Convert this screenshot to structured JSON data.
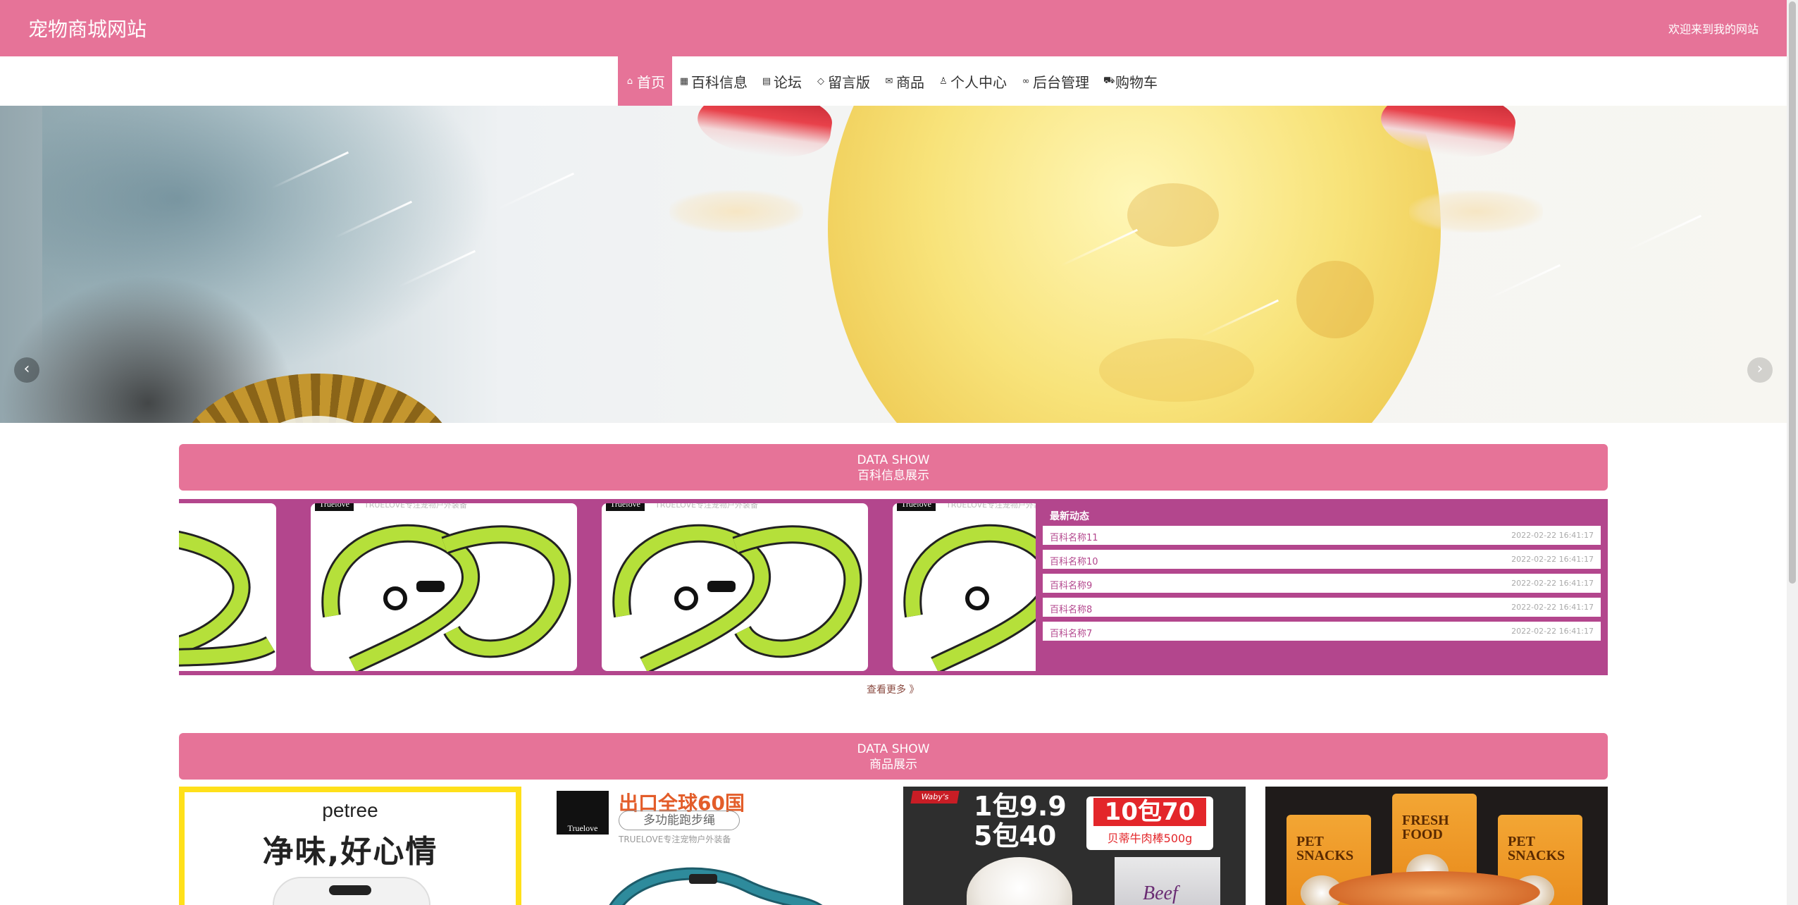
{
  "header": {
    "site_title": "宠物商城网站",
    "welcome": "欢迎来到我的网站"
  },
  "nav": {
    "items": [
      {
        "label": "首页",
        "icon": "home-icon",
        "active": true
      },
      {
        "label": "百科信息",
        "icon": "gift-icon",
        "active": false
      },
      {
        "label": "论坛",
        "icon": "forum-icon",
        "active": false
      },
      {
        "label": "留言版",
        "icon": "tag-icon",
        "active": false
      },
      {
        "label": "商品",
        "icon": "mail-icon",
        "active": false
      },
      {
        "label": "个人中心",
        "icon": "user-icon",
        "active": false
      },
      {
        "label": "后台管理",
        "icon": "link-icon",
        "active": false
      },
      {
        "label": "购物车",
        "icon": "cart-icon",
        "active": false
      }
    ]
  },
  "carousel": {
    "prev_icon": "chevron-left-icon",
    "next_icon": "chevron-right-icon",
    "slide_count": 3,
    "active_slide": 1
  },
  "encyclopedia_section": {
    "heading_en": "DATA SHOW",
    "heading_cn": "百科信息展示",
    "slide_brand": "Truelove",
    "slide_tagline": "TRUELOVE专注宠物户外装备",
    "news_title": "最新动态",
    "news": [
      {
        "name": "百科名称11",
        "time": "2022-02-22 16:41:17"
      },
      {
        "name": "百科名称10",
        "time": "2022-02-22 16:41:17"
      },
      {
        "name": "百科名称9",
        "time": "2022-02-22 16:41:17"
      },
      {
        "name": "百科名称8",
        "time": "2022-02-22 16:41:17"
      },
      {
        "name": "百科名称7",
        "time": "2022-02-22 16:41:17"
      }
    ],
    "more_label": "查看更多 》"
  },
  "product_section": {
    "heading_en": "DATA SHOW",
    "heading_cn": "商品展示",
    "p1": {
      "brand": "petree",
      "slogan": "净味,好心情"
    },
    "p2": {
      "logo": "Truelove",
      "headline": "出口全球60国",
      "subhead": "多功能跑步绳",
      "tagline": "TRUELOVE专注宠物户外装备"
    },
    "p3": {
      "tag": "Waby's",
      "line1": "1包9.9",
      "line2": "5包40",
      "badge": "10包70",
      "badge_sub": "贝蒂牛肉棒500g",
      "bag_text": "Beef"
    },
    "p4": {
      "pack_text_1": "PET SNACKS",
      "pack_text_2": "FRESH FOOD"
    }
  },
  "colors": {
    "primary": "#e67398",
    "showcase_bg": "#b3468d",
    "leash_green": "#b5e03a"
  }
}
